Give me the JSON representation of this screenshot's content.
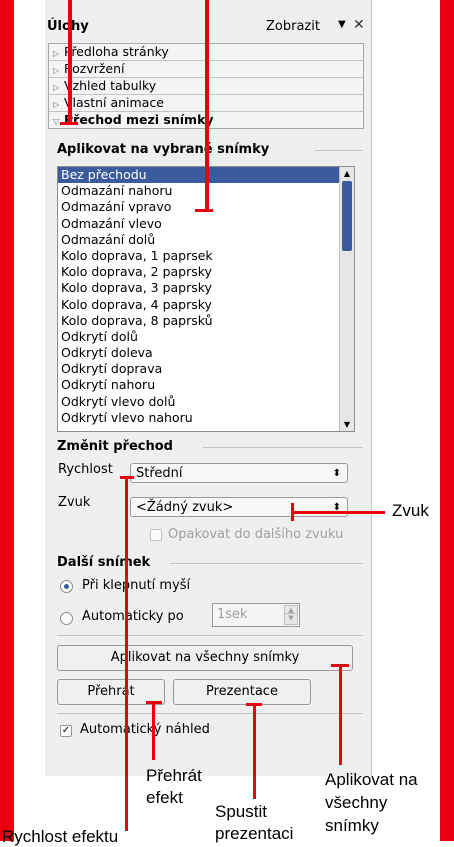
{
  "panel": {
    "title": "Úlohy",
    "view_label": "Zobrazit",
    "dropdown_arrow": "▼",
    "close": "✕"
  },
  "sections": [
    {
      "label": "Předloha stránky",
      "icon": "expand-triangle-icon"
    },
    {
      "label": "Rozvržení",
      "icon": "expand-triangle-icon"
    },
    {
      "label": "Vzhled tabulky",
      "icon": "expand-triangle-icon"
    },
    {
      "label": "Vlastní animace",
      "icon": "expand-triangle-icon"
    },
    {
      "label": "Přechod mezi snímky",
      "icon": "collapse-triangle-icon"
    }
  ],
  "apply_group": {
    "title": "Aplikovat na vybrané snímky",
    "transitions": [
      "Bez přechodu",
      "Odmazání nahoru",
      "Odmazání vpravo",
      "Odmazání vlevo",
      "Odmazání dolů",
      "Kolo doprava, 1 paprsek",
      "Kolo doprava, 2 paprsky",
      "Kolo doprava, 3 paprsky",
      "Kolo doprava, 4 paprsky",
      "Kolo doprava, 8 paprsků",
      "Odkrytí dolů",
      "Odkrytí doleva",
      "Odkrytí doprava",
      "Odkrytí nahoru",
      "Odkrytí vlevo dolů",
      "Odkrytí vlevo nahoru"
    ],
    "selected": "Bez přechodu"
  },
  "modify_group": {
    "title": "Změnit přechod",
    "speed_label": "Rychlost",
    "speed_value": "Střední",
    "sound_label": "Zvuk",
    "sound_value": "<Žádný zvuk>",
    "loop_label": "Opakovat do dalšího zvuku",
    "loop_checked": false
  },
  "next_group": {
    "title": "Další snímek",
    "on_click_label": "Při klepnutí myší",
    "auto_label": "Automaticky po",
    "auto_value": "1sek",
    "selected": "on_click"
  },
  "buttons": {
    "apply_all": "Aplikovat na všechny snímky",
    "play": "Přehrát",
    "slideshow": "Prezentace"
  },
  "auto_preview": {
    "label": "Automatický náhled",
    "checked": true
  },
  "annotations": {
    "sound": "Zvuk",
    "play_l1": "Přehrát",
    "play_l2": "efekt",
    "slideshow_l1": "Spustit",
    "slideshow_l2": "prezentaci",
    "apply_l1": "Aplikovat na",
    "apply_l2": "všechny",
    "apply_l3": "snímky",
    "speed": "Rychlost efektu"
  },
  "colors": {
    "annotation_red": "#e8000f",
    "selection_blue": "#3a5c9e"
  }
}
